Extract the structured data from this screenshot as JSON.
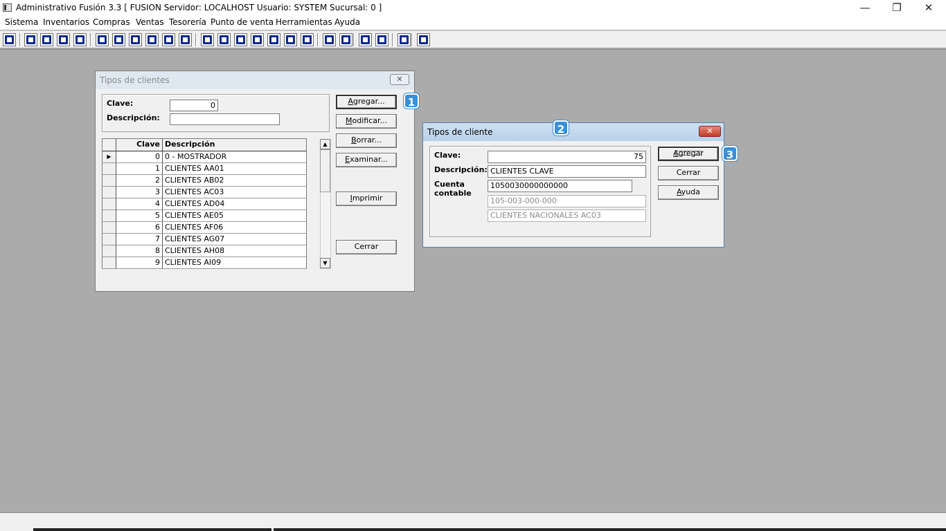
{
  "window": {
    "title": "Administrativo Fusión 3.3 [ FUSION   Servidor: LOCALHOST    Usuario: SYSTEM     Sucursal: 0 ]",
    "controls": {
      "minimize": "—",
      "restore": "❐",
      "close": "✕"
    }
  },
  "menu": [
    "Sistema",
    "Inventarios",
    "Compras",
    "Ventas",
    "Tesorería",
    "Punto de venta",
    "Herramientas",
    "Ayuda"
  ],
  "toolbar_icons": [
    "calculator-icon",
    "copy-icon",
    "paste-icon",
    "exchange-icon",
    "search-icon",
    "user-icon",
    "folder-icon",
    "print-icon",
    "printer-icon",
    "document-icon",
    "list-icon",
    "binoculars-icon",
    "folder-open-icon",
    "export-icon",
    "add-icon",
    "money-icon",
    "report-icon",
    "table-icon",
    "home-icon",
    "zoom-icon",
    "refresh-icon",
    "undo-icon",
    "back-icon",
    "help-icon"
  ],
  "dialog1": {
    "title": "Tipos de clientes",
    "close": "✕",
    "clave_label": "Clave:",
    "clave_value": "0",
    "desc_label": "Descripción:",
    "desc_value": "",
    "grid_headers": {
      "clave": "Clave",
      "descripcion": "Descripción"
    },
    "current_marker": "▶",
    "rows": [
      {
        "clave": "0",
        "descripcion": "0 - MOSTRADOR"
      },
      {
        "clave": "1",
        "descripcion": "CLIENTES AA01"
      },
      {
        "clave": "2",
        "descripcion": "CLIENTES AB02"
      },
      {
        "clave": "3",
        "descripcion": "CLIENTES AC03"
      },
      {
        "clave": "4",
        "descripcion": "CLIENTES AD04"
      },
      {
        "clave": "5",
        "descripcion": "CLIENTES AE05"
      },
      {
        "clave": "6",
        "descripcion": "CLIENTES AF06"
      },
      {
        "clave": "7",
        "descripcion": "CLIENTES AG07"
      },
      {
        "clave": "8",
        "descripcion": "CLIENTES AH08"
      },
      {
        "clave": "9",
        "descripcion": "CLIENTES AI09"
      }
    ],
    "scroll_up": "▲",
    "scroll_down": "▼",
    "buttons": {
      "agregar": {
        "pre": "",
        "key": "A",
        "post": "gregar..."
      },
      "modificar": {
        "pre": "",
        "key": "M",
        "post": "odificar..."
      },
      "borrar": {
        "pre": "",
        "key": "B",
        "post": "orrar..."
      },
      "examinar": {
        "pre": "",
        "key": "E",
        "post": "xaminar..."
      },
      "imprimir": {
        "pre": "",
        "key": "I",
        "post": "mprimir"
      },
      "cerrar": {
        "pre": "",
        "key": "",
        "post": "Cerrar"
      }
    }
  },
  "dialog2": {
    "title": "Tipos de cliente",
    "close": "✕",
    "clave_label": "Clave:",
    "clave_value": "75",
    "desc_label": "Descripción:",
    "desc_value": "CLIENTES CLAVE",
    "cuenta_label_1": "Cuenta",
    "cuenta_label_2": "contable",
    "cuenta_value": "1050030000000000",
    "cuenta_formatted": "105-003-000-000",
    "cuenta_nombre": "CLIENTES NACIONALES AC03",
    "buttons": {
      "agregar": {
        "pre": "",
        "key": "A",
        "post": "gregar"
      },
      "cerrar": "Cerrar",
      "ayuda": {
        "pre": "",
        "key": "A",
        "post": "yuda"
      }
    }
  },
  "badges": {
    "b1": "1",
    "b2": "2",
    "b3": "3"
  }
}
